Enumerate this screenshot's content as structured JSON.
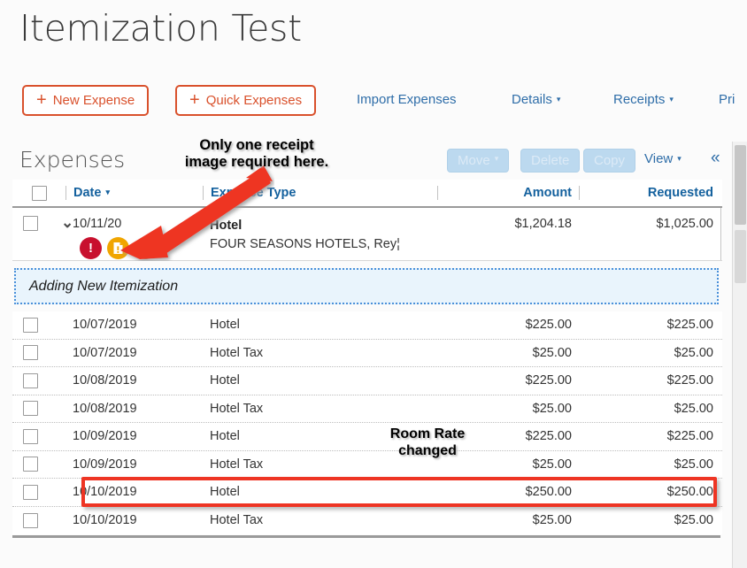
{
  "page": {
    "title": "Itemization Test"
  },
  "actionbar": {
    "new_expense": "New Expense",
    "quick_expenses": "Quick Expenses",
    "import_expenses": "Import Expenses",
    "details": "Details",
    "receipts": "Receipts",
    "print": "Pri",
    "plus_glyph": "+",
    "caret_glyph": "▾"
  },
  "expenses_section": {
    "title": "Expenses",
    "move": "Move",
    "delete": "Delete",
    "copy": "Copy",
    "view": "View",
    "collapse_glyph": "«",
    "caret_glyph": "▾"
  },
  "grid": {
    "columns": [
      "",
      "Date",
      "Expense Type",
      "Amount",
      "Requested"
    ],
    "sort_caret": "▾",
    "parent_row": {
      "date": "10/11/20",
      "type_main": "Hotel",
      "type_sub": "FOUR SEASONS HOTELS, Rey¦",
      "amount": "$1,204.18",
      "requested": "$1,025.00",
      "expander_glyph": "⌄",
      "icons": [
        {
          "name": "exception-icon",
          "glyph": "!",
          "color": "#c8102e"
        },
        {
          "name": "receipt-required-icon",
          "glyph": "❙",
          "color": "#f0a500"
        },
        {
          "name": "allocation-icon",
          "glyph": "=",
          "color": "#1a9e4b"
        }
      ]
    },
    "adding_banner": "Adding New Itemization",
    "itemizations": [
      {
        "date": "10/07/2019",
        "type": "Hotel",
        "amount": "$225.00",
        "requested": "$225.00"
      },
      {
        "date": "10/07/2019",
        "type": "Hotel Tax",
        "amount": "$25.00",
        "requested": "$25.00"
      },
      {
        "date": "10/08/2019",
        "type": "Hotel",
        "amount": "$225.00",
        "requested": "$225.00"
      },
      {
        "date": "10/08/2019",
        "type": "Hotel Tax",
        "amount": "$25.00",
        "requested": "$25.00"
      },
      {
        "date": "10/09/2019",
        "type": "Hotel",
        "amount": "$225.00",
        "requested": "$225.00"
      },
      {
        "date": "10/09/2019",
        "type": "Hotel Tax",
        "amount": "$25.00",
        "requested": "$25.00"
      },
      {
        "date": "10/10/2019",
        "type": "Hotel",
        "amount": "$250.00",
        "requested": "$250.00"
      },
      {
        "date": "10/10/2019",
        "type": "Hotel Tax",
        "amount": "$25.00",
        "requested": "$25.00"
      }
    ]
  },
  "annotations": {
    "receipt_note_line1": "Only one receipt",
    "receipt_note_line2": "image required here.",
    "room_rate_line1": "Room Rate",
    "room_rate_line2": "changed",
    "arrow_color": "#ee3524",
    "highlight_color": "#ee3524"
  }
}
